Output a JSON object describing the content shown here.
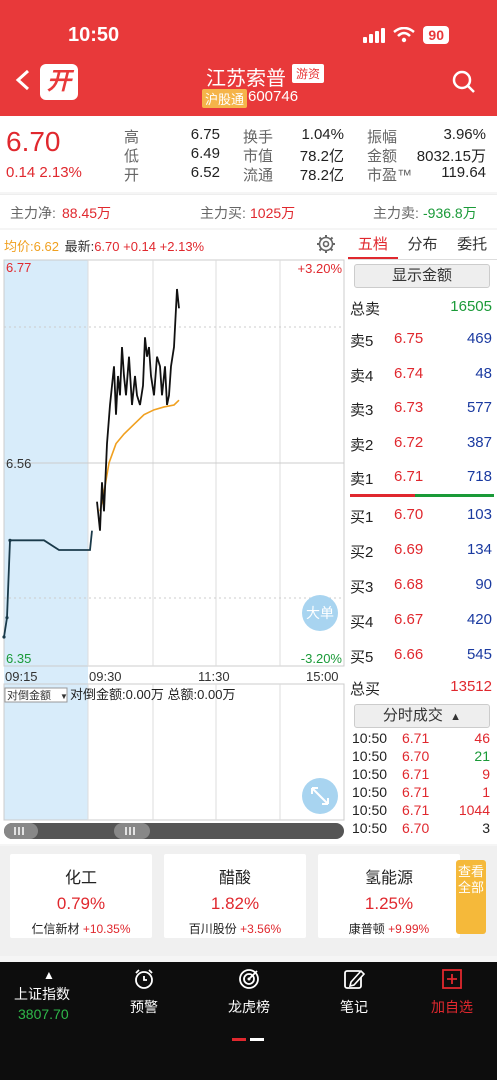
{
  "status": {
    "time": "10:50",
    "battery": "90"
  },
  "header": {
    "logo": "开",
    "title": "江苏索普",
    "tag": "游资",
    "exchange_tag": "沪股通",
    "code": "600746"
  },
  "quote": {
    "price": "6.70",
    "change": "0.14  2.13%",
    "stats": [
      {
        "label": "高",
        "value": "6.75"
      },
      {
        "label": "低",
        "value": "6.49"
      },
      {
        "label": "开",
        "value": "6.52"
      },
      {
        "label": "换手",
        "value": "1.04%"
      },
      {
        "label": "市值",
        "value": "78.2亿"
      },
      {
        "label": "流通",
        "value": "78.2亿"
      },
      {
        "label": "振幅",
        "value": "3.96%"
      },
      {
        "label": "金额",
        "value": "8032.15万"
      },
      {
        "label": "市盈™",
        "value": "119.64"
      }
    ]
  },
  "flow": {
    "net_label": "主力净:",
    "net_value": "88.45万",
    "buy_label": "主力买:",
    "buy_value": "1025万",
    "sell_label": "主力卖:",
    "sell_value": "-936.8万"
  },
  "chart_head": {
    "avg_label": "均价:",
    "avg_value": "6.62",
    "last_label": "最新:",
    "last_value": "6.70",
    "chg": "+0.14",
    "pct": "+2.13%"
  },
  "chart_data": {
    "type": "line",
    "y_top": "6.77",
    "y_mid": "6.56",
    "y_bottom": "6.35",
    "pct_top": "+3.20%",
    "pct_bottom": "-3.20%",
    "x_ticks": [
      "09:15",
      "09:30",
      "11:30",
      "15:00"
    ],
    "ylim": [
      6.35,
      6.77
    ],
    "auction_price": [
      [
        0,
        6.38
      ],
      [
        3,
        6.4
      ],
      [
        6,
        6.48
      ],
      [
        20,
        6.48
      ],
      [
        40,
        6.48
      ],
      [
        55,
        6.47
      ],
      [
        75,
        6.47
      ],
      [
        86,
        6.47
      ],
      [
        88,
        6.49
      ]
    ],
    "price": [
      [
        93,
        6.52
      ],
      [
        96,
        6.49
      ],
      [
        98,
        6.54
      ],
      [
        100,
        6.51
      ],
      [
        103,
        6.58
      ],
      [
        106,
        6.62
      ],
      [
        108,
        6.64
      ],
      [
        110,
        6.66
      ],
      [
        112,
        6.61
      ],
      [
        114,
        6.65
      ],
      [
        116,
        6.63
      ],
      [
        118,
        6.68
      ],
      [
        120,
        6.65
      ],
      [
        122,
        6.63
      ],
      [
        125,
        6.67
      ],
      [
        128,
        6.62
      ],
      [
        131,
        6.65
      ],
      [
        133,
        6.63
      ],
      [
        136,
        6.62
      ],
      [
        139,
        6.64
      ],
      [
        141,
        6.69
      ],
      [
        143,
        6.67
      ],
      [
        145,
        6.68
      ],
      [
        147,
        6.65
      ],
      [
        150,
        6.63
      ],
      [
        153,
        6.67
      ],
      [
        156,
        6.66
      ],
      [
        158,
        6.63
      ],
      [
        161,
        6.66
      ],
      [
        163,
        6.62
      ],
      [
        165,
        6.63
      ],
      [
        167,
        6.66
      ],
      [
        170,
        6.68
      ],
      [
        173,
        6.74
      ],
      [
        175,
        6.72
      ]
    ],
    "avg_price": [
      [
        96,
        6.51
      ],
      [
        100,
        6.53
      ],
      [
        105,
        6.56
      ],
      [
        112,
        6.58
      ],
      [
        120,
        6.59
      ],
      [
        130,
        6.6
      ],
      [
        140,
        6.61
      ],
      [
        150,
        6.615
      ],
      [
        160,
        6.618
      ],
      [
        170,
        6.62
      ],
      [
        175,
        6.625
      ]
    ],
    "sub_label": "对倒金额",
    "sub_text": "对倒金额:0.00万 总额:0.00万",
    "big_order_label": "大单"
  },
  "side": {
    "tabs": [
      "五档",
      "分布",
      "委托"
    ],
    "show_amount": "显示金额",
    "total_sell_label": "总卖",
    "total_sell": "16505",
    "asks": [
      {
        "label": "卖5",
        "price": "6.75",
        "vol": "469"
      },
      {
        "label": "卖4",
        "price": "6.74",
        "vol": "48"
      },
      {
        "label": "卖3",
        "price": "6.73",
        "vol": "577"
      },
      {
        "label": "卖2",
        "price": "6.72",
        "vol": "387"
      },
      {
        "label": "卖1",
        "price": "6.71",
        "vol": "718"
      }
    ],
    "bids": [
      {
        "label": "买1",
        "price": "6.70",
        "vol": "103"
      },
      {
        "label": "买2",
        "price": "6.69",
        "vol": "134"
      },
      {
        "label": "买3",
        "price": "6.68",
        "vol": "90"
      },
      {
        "label": "买4",
        "price": "6.67",
        "vol": "420"
      },
      {
        "label": "买5",
        "price": "6.66",
        "vol": "545"
      }
    ],
    "total_buy_label": "总买",
    "total_buy": "13512",
    "ticks_btn": "分时成交",
    "ticks": [
      {
        "time": "10:50",
        "price": "6.71",
        "vol": "46",
        "dir": "red"
      },
      {
        "time": "10:50",
        "price": "6.70",
        "vol": "21",
        "dir": "green"
      },
      {
        "time": "10:50",
        "price": "6.71",
        "vol": "9",
        "dir": "red"
      },
      {
        "time": "10:50",
        "price": "6.71",
        "vol": "1",
        "dir": "red"
      },
      {
        "time": "10:50",
        "price": "6.71",
        "vol": "1044",
        "dir": "red"
      },
      {
        "time": "10:50",
        "price": "6.70",
        "vol": "3",
        "dir": "black"
      }
    ]
  },
  "sectors": [
    {
      "name": "化工",
      "pct": "0.79%",
      "lead": "仁信新材",
      "lead_pct": "+10.35%"
    },
    {
      "name": "醋酸",
      "pct": "1.82%",
      "lead": "百川股份",
      "lead_pct": "+3.56%"
    },
    {
      "name": "氢能源",
      "pct": "1.25%",
      "lead": "康普顿",
      "lead_pct": "+9.99%"
    }
  ],
  "see_all": "查看全部",
  "bottom_nav": {
    "index_name": "上证指数",
    "index_value": "3807.70",
    "items": [
      "预警",
      "龙虎榜",
      "笔记",
      "加自选"
    ]
  },
  "colors": {
    "up": "#e0282e",
    "down": "#1a9a38",
    "header": "#e8393a",
    "avg_line": "#f0a020"
  }
}
